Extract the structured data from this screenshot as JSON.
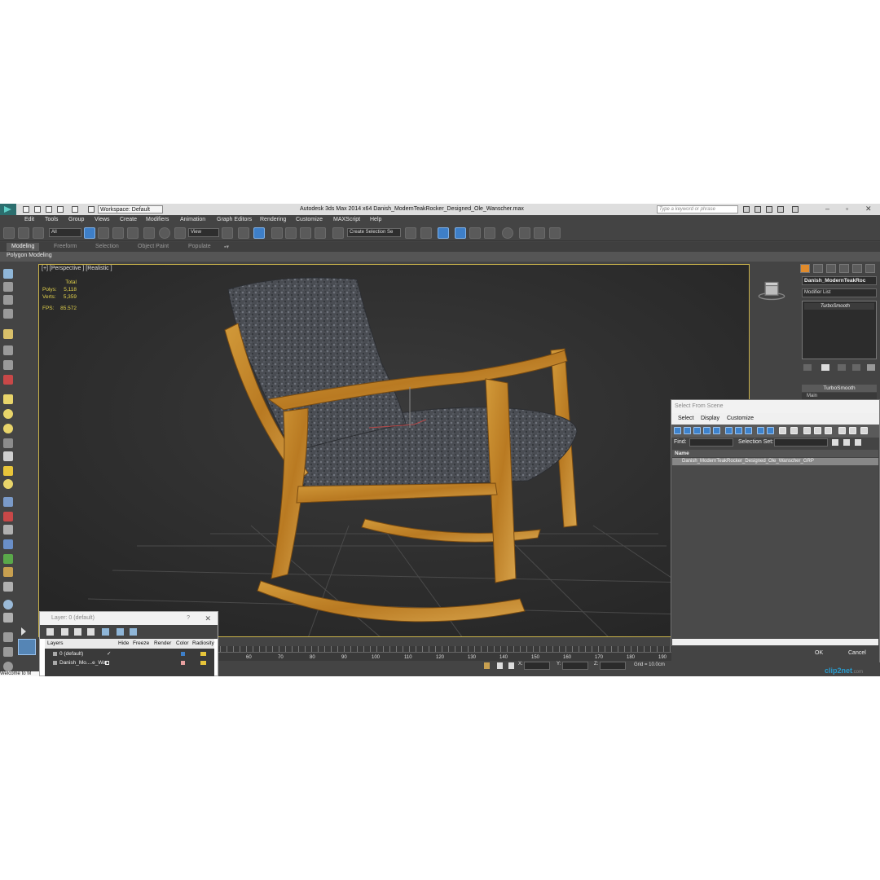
{
  "titlebar": {
    "workspace": "Workspace: Default",
    "title": "Autodesk 3ds Max  2014 x64     Danish_ModernTeakRocker_Designed_Ole_Wanscher.max",
    "search_placeholder": "Type a keyword or phrase"
  },
  "menu": [
    "Edit",
    "Tools",
    "Group",
    "Views",
    "Create",
    "Modifiers",
    "Animation",
    "Graph Editors",
    "Rendering",
    "Customize",
    "MAXScript",
    "Help"
  ],
  "toolbar": {
    "selection_filter": "All",
    "ref_coord": "View",
    "selection_set": "Create Selection Se"
  },
  "ribbon": {
    "tabs": [
      "Modeling",
      "Freeform",
      "Selection",
      "Object Paint",
      "Populate"
    ],
    "active": "Modeling",
    "sub": "Polygon Modeling"
  },
  "viewport": {
    "label": "[+] [Perspective ] [Realistic ]",
    "stats": {
      "total_label": "Total",
      "polys_label": "Polys:",
      "polys": "5,118",
      "verts_label": "Verts:",
      "verts": "5,359",
      "fps_label": "FPS:",
      "fps": "85.572"
    }
  },
  "command_panel": {
    "object_name": "Danish_ModernTeakRoc",
    "modifier_list": "Modifier List",
    "stack_item": "TurboSmooth",
    "rollout_title": "TurboSmooth",
    "rollout_main": "Main"
  },
  "select_from_scene": {
    "title": "Select From Scene",
    "menus": [
      "Select",
      "Display",
      "Customize"
    ],
    "find_label": "Find:",
    "selection_set_label": "Selection Set:",
    "column_name": "Name",
    "row": "Danish_ModernTeakRocker_Designed_Ole_Wanscher_GRP",
    "ok": "OK",
    "cancel": "Cancel"
  },
  "timeline": {
    "ticks": [
      "60",
      "70",
      "80",
      "90",
      "100",
      "110",
      "120",
      "130",
      "140",
      "150",
      "160",
      "170",
      "180",
      "190"
    ]
  },
  "status": {
    "x_label": "X:",
    "y_label": "Y:",
    "z_label": "Z:",
    "grid": "Grid = 10.0cm"
  },
  "layer_dialog": {
    "title": "Layer: 0 (default)",
    "help": "?",
    "close": "✕",
    "columns": [
      "Layers",
      "Hide",
      "Freeze",
      "Render",
      "Color",
      "Radiosity"
    ],
    "rows": [
      "0 (default)",
      "Danish_Mo....e_War"
    ]
  },
  "maxscript_text": "Welcome to M",
  "watermark": {
    "brand": "clip2net",
    "tld": ".com"
  },
  "colors": {
    "viewport_border": "#c9b24a",
    "stats": "#e3d24b",
    "wood": "#c8882a",
    "fabric": "#4c4f55",
    "accent_blue": "#3e7fc8",
    "active_tab": "#e08b2c"
  }
}
